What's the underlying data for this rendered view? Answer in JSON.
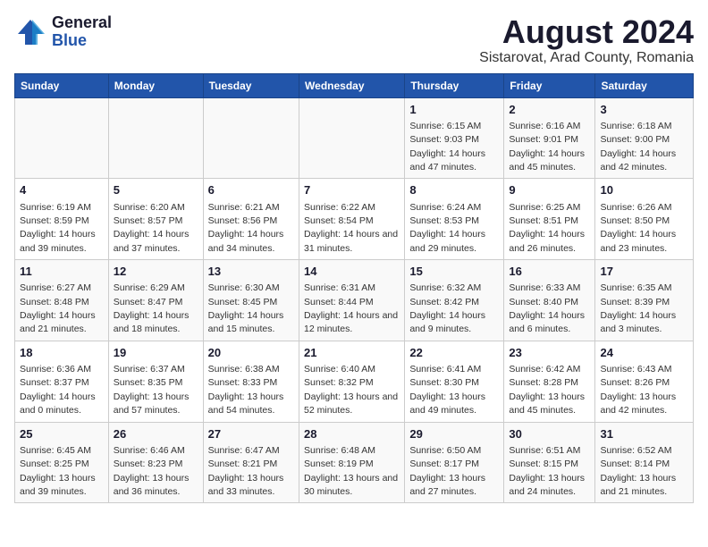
{
  "logo": {
    "general": "General",
    "blue": "Blue"
  },
  "title": "August 2024",
  "subtitle": "Sistarovat, Arad County, Romania",
  "days_of_week": [
    "Sunday",
    "Monday",
    "Tuesday",
    "Wednesday",
    "Thursday",
    "Friday",
    "Saturday"
  ],
  "weeks": [
    [
      {
        "day": "",
        "info": ""
      },
      {
        "day": "",
        "info": ""
      },
      {
        "day": "",
        "info": ""
      },
      {
        "day": "",
        "info": ""
      },
      {
        "day": "1",
        "info": "Sunrise: 6:15 AM\nSunset: 9:03 PM\nDaylight: 14 hours and 47 minutes."
      },
      {
        "day": "2",
        "info": "Sunrise: 6:16 AM\nSunset: 9:01 PM\nDaylight: 14 hours and 45 minutes."
      },
      {
        "day": "3",
        "info": "Sunrise: 6:18 AM\nSunset: 9:00 PM\nDaylight: 14 hours and 42 minutes."
      }
    ],
    [
      {
        "day": "4",
        "info": "Sunrise: 6:19 AM\nSunset: 8:59 PM\nDaylight: 14 hours and 39 minutes."
      },
      {
        "day": "5",
        "info": "Sunrise: 6:20 AM\nSunset: 8:57 PM\nDaylight: 14 hours and 37 minutes."
      },
      {
        "day": "6",
        "info": "Sunrise: 6:21 AM\nSunset: 8:56 PM\nDaylight: 14 hours and 34 minutes."
      },
      {
        "day": "7",
        "info": "Sunrise: 6:22 AM\nSunset: 8:54 PM\nDaylight: 14 hours and 31 minutes."
      },
      {
        "day": "8",
        "info": "Sunrise: 6:24 AM\nSunset: 8:53 PM\nDaylight: 14 hours and 29 minutes."
      },
      {
        "day": "9",
        "info": "Sunrise: 6:25 AM\nSunset: 8:51 PM\nDaylight: 14 hours and 26 minutes."
      },
      {
        "day": "10",
        "info": "Sunrise: 6:26 AM\nSunset: 8:50 PM\nDaylight: 14 hours and 23 minutes."
      }
    ],
    [
      {
        "day": "11",
        "info": "Sunrise: 6:27 AM\nSunset: 8:48 PM\nDaylight: 14 hours and 21 minutes."
      },
      {
        "day": "12",
        "info": "Sunrise: 6:29 AM\nSunset: 8:47 PM\nDaylight: 14 hours and 18 minutes."
      },
      {
        "day": "13",
        "info": "Sunrise: 6:30 AM\nSunset: 8:45 PM\nDaylight: 14 hours and 15 minutes."
      },
      {
        "day": "14",
        "info": "Sunrise: 6:31 AM\nSunset: 8:44 PM\nDaylight: 14 hours and 12 minutes."
      },
      {
        "day": "15",
        "info": "Sunrise: 6:32 AM\nSunset: 8:42 PM\nDaylight: 14 hours and 9 minutes."
      },
      {
        "day": "16",
        "info": "Sunrise: 6:33 AM\nSunset: 8:40 PM\nDaylight: 14 hours and 6 minutes."
      },
      {
        "day": "17",
        "info": "Sunrise: 6:35 AM\nSunset: 8:39 PM\nDaylight: 14 hours and 3 minutes."
      }
    ],
    [
      {
        "day": "18",
        "info": "Sunrise: 6:36 AM\nSunset: 8:37 PM\nDaylight: 14 hours and 0 minutes."
      },
      {
        "day": "19",
        "info": "Sunrise: 6:37 AM\nSunset: 8:35 PM\nDaylight: 13 hours and 57 minutes."
      },
      {
        "day": "20",
        "info": "Sunrise: 6:38 AM\nSunset: 8:33 PM\nDaylight: 13 hours and 54 minutes."
      },
      {
        "day": "21",
        "info": "Sunrise: 6:40 AM\nSunset: 8:32 PM\nDaylight: 13 hours and 52 minutes."
      },
      {
        "day": "22",
        "info": "Sunrise: 6:41 AM\nSunset: 8:30 PM\nDaylight: 13 hours and 49 minutes."
      },
      {
        "day": "23",
        "info": "Sunrise: 6:42 AM\nSunset: 8:28 PM\nDaylight: 13 hours and 45 minutes."
      },
      {
        "day": "24",
        "info": "Sunrise: 6:43 AM\nSunset: 8:26 PM\nDaylight: 13 hours and 42 minutes."
      }
    ],
    [
      {
        "day": "25",
        "info": "Sunrise: 6:45 AM\nSunset: 8:25 PM\nDaylight: 13 hours and 39 minutes."
      },
      {
        "day": "26",
        "info": "Sunrise: 6:46 AM\nSunset: 8:23 PM\nDaylight: 13 hours and 36 minutes."
      },
      {
        "day": "27",
        "info": "Sunrise: 6:47 AM\nSunset: 8:21 PM\nDaylight: 13 hours and 33 minutes."
      },
      {
        "day": "28",
        "info": "Sunrise: 6:48 AM\nSunset: 8:19 PM\nDaylight: 13 hours and 30 minutes."
      },
      {
        "day": "29",
        "info": "Sunrise: 6:50 AM\nSunset: 8:17 PM\nDaylight: 13 hours and 27 minutes."
      },
      {
        "day": "30",
        "info": "Sunrise: 6:51 AM\nSunset: 8:15 PM\nDaylight: 13 hours and 24 minutes."
      },
      {
        "day": "31",
        "info": "Sunrise: 6:52 AM\nSunset: 8:14 PM\nDaylight: 13 hours and 21 minutes."
      }
    ]
  ]
}
